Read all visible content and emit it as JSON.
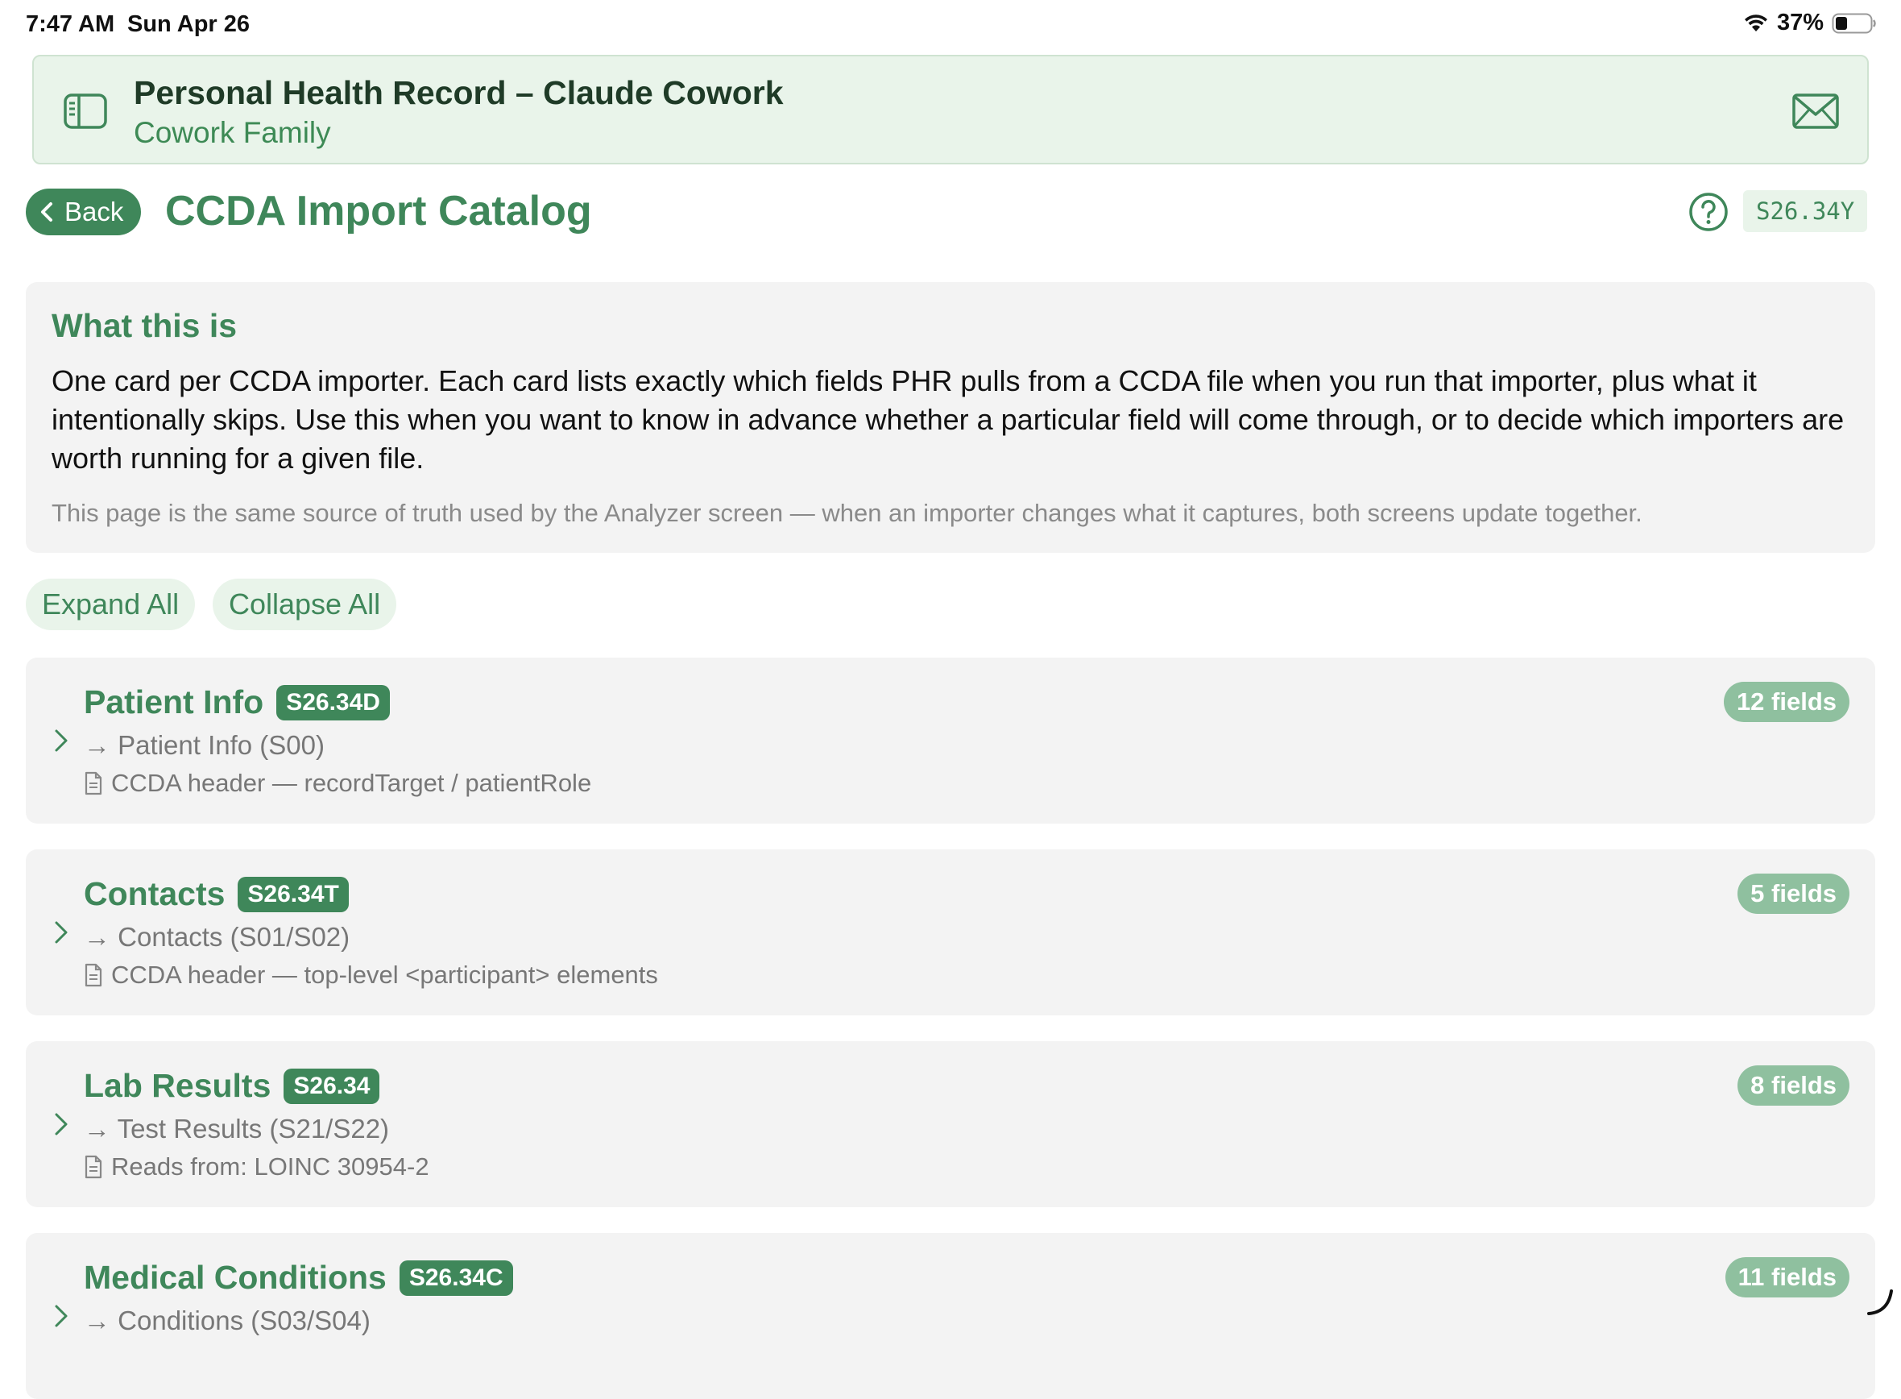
{
  "status_bar": {
    "time": "7:47 AM",
    "date": "Sun Apr 26",
    "battery": "37%",
    "battery_level": 0.37
  },
  "header": {
    "title": "Personal Health Record – Claude Cowork",
    "subtitle": "Cowork Family",
    "sidebar_icon": "sidebar-icon",
    "mail_icon": "envelope-icon"
  },
  "page": {
    "back_label": "Back",
    "title": "CCDA Import Catalog",
    "version": "S26.34Y",
    "help_icon": "question-circle-icon"
  },
  "info": {
    "heading": "What this is",
    "body": "One card per CCDA importer. Each card lists exactly which fields PHR pulls from a CCDA file when you run that importer, plus what it intentionally skips. Use this when you want to know in advance whether a particular field will come through, or to decide which importers are worth running for a given file.",
    "note": "This page is the same source of truth used by the Analyzer screen — when an importer changes what it captures, both screens update together."
  },
  "actions": {
    "expand_all": "Expand All",
    "collapse_all": "Collapse All"
  },
  "importers": [
    {
      "title": "Patient Info",
      "code": "S26.34D",
      "target": "→ Patient Info (S00)",
      "source": "CCDA header — recordTarget / patientRole",
      "fields": "12 fields"
    },
    {
      "title": "Contacts",
      "code": "S26.34T",
      "target": "→ Contacts (S01/S02)",
      "source": "CCDA header — top-level <participant> elements",
      "fields": "5 fields"
    },
    {
      "title": "Lab Results",
      "code": "S26.34",
      "target": "→ Test Results (S21/S22)",
      "source": "Reads from: LOINC 30954-2",
      "fields": "8 fields"
    },
    {
      "title": "Medical Conditions",
      "code": "S26.34C",
      "target": "→ Conditions (S03/S04)",
      "source": "",
      "fields": "11 fields"
    }
  ],
  "colors": {
    "accent": "#3f875a",
    "banner_bg": "#e9f4ea",
    "card_bg": "#f3f3f3",
    "fields_badge": "#8fc09f"
  }
}
